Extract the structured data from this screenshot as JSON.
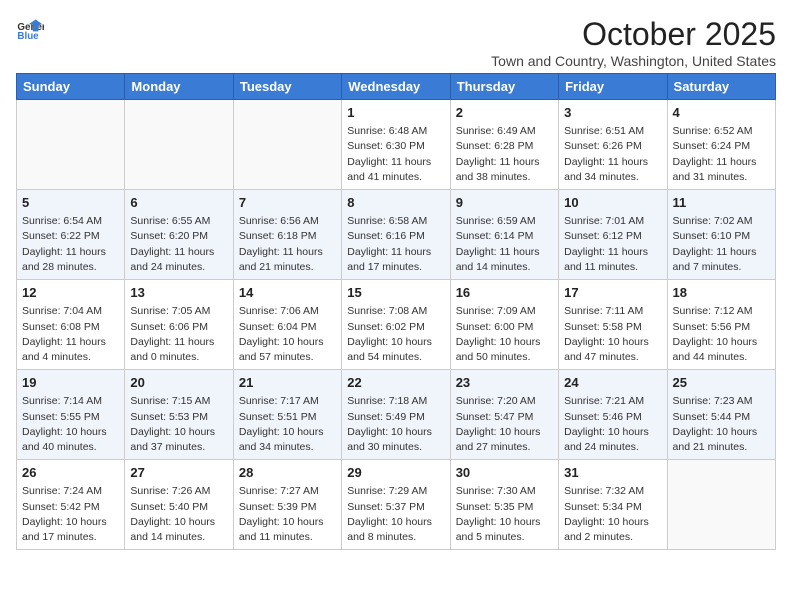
{
  "logo": {
    "general": "General",
    "blue": "Blue"
  },
  "title": "October 2025",
  "subtitle": "Town and Country, Washington, United States",
  "days_header": [
    "Sunday",
    "Monday",
    "Tuesday",
    "Wednesday",
    "Thursday",
    "Friday",
    "Saturday"
  ],
  "weeks": [
    [
      {
        "num": "",
        "info": ""
      },
      {
        "num": "",
        "info": ""
      },
      {
        "num": "",
        "info": ""
      },
      {
        "num": "1",
        "info": "Sunrise: 6:48 AM\nSunset: 6:30 PM\nDaylight: 11 hours\nand 41 minutes."
      },
      {
        "num": "2",
        "info": "Sunrise: 6:49 AM\nSunset: 6:28 PM\nDaylight: 11 hours\nand 38 minutes."
      },
      {
        "num": "3",
        "info": "Sunrise: 6:51 AM\nSunset: 6:26 PM\nDaylight: 11 hours\nand 34 minutes."
      },
      {
        "num": "4",
        "info": "Sunrise: 6:52 AM\nSunset: 6:24 PM\nDaylight: 11 hours\nand 31 minutes."
      }
    ],
    [
      {
        "num": "5",
        "info": "Sunrise: 6:54 AM\nSunset: 6:22 PM\nDaylight: 11 hours\nand 28 minutes."
      },
      {
        "num": "6",
        "info": "Sunrise: 6:55 AM\nSunset: 6:20 PM\nDaylight: 11 hours\nand 24 minutes."
      },
      {
        "num": "7",
        "info": "Sunrise: 6:56 AM\nSunset: 6:18 PM\nDaylight: 11 hours\nand 21 minutes."
      },
      {
        "num": "8",
        "info": "Sunrise: 6:58 AM\nSunset: 6:16 PM\nDaylight: 11 hours\nand 17 minutes."
      },
      {
        "num": "9",
        "info": "Sunrise: 6:59 AM\nSunset: 6:14 PM\nDaylight: 11 hours\nand 14 minutes."
      },
      {
        "num": "10",
        "info": "Sunrise: 7:01 AM\nSunset: 6:12 PM\nDaylight: 11 hours\nand 11 minutes."
      },
      {
        "num": "11",
        "info": "Sunrise: 7:02 AM\nSunset: 6:10 PM\nDaylight: 11 hours\nand 7 minutes."
      }
    ],
    [
      {
        "num": "12",
        "info": "Sunrise: 7:04 AM\nSunset: 6:08 PM\nDaylight: 11 hours\nand 4 minutes."
      },
      {
        "num": "13",
        "info": "Sunrise: 7:05 AM\nSunset: 6:06 PM\nDaylight: 11 hours\nand 0 minutes."
      },
      {
        "num": "14",
        "info": "Sunrise: 7:06 AM\nSunset: 6:04 PM\nDaylight: 10 hours\nand 57 minutes."
      },
      {
        "num": "15",
        "info": "Sunrise: 7:08 AM\nSunset: 6:02 PM\nDaylight: 10 hours\nand 54 minutes."
      },
      {
        "num": "16",
        "info": "Sunrise: 7:09 AM\nSunset: 6:00 PM\nDaylight: 10 hours\nand 50 minutes."
      },
      {
        "num": "17",
        "info": "Sunrise: 7:11 AM\nSunset: 5:58 PM\nDaylight: 10 hours\nand 47 minutes."
      },
      {
        "num": "18",
        "info": "Sunrise: 7:12 AM\nSunset: 5:56 PM\nDaylight: 10 hours\nand 44 minutes."
      }
    ],
    [
      {
        "num": "19",
        "info": "Sunrise: 7:14 AM\nSunset: 5:55 PM\nDaylight: 10 hours\nand 40 minutes."
      },
      {
        "num": "20",
        "info": "Sunrise: 7:15 AM\nSunset: 5:53 PM\nDaylight: 10 hours\nand 37 minutes."
      },
      {
        "num": "21",
        "info": "Sunrise: 7:17 AM\nSunset: 5:51 PM\nDaylight: 10 hours\nand 34 minutes."
      },
      {
        "num": "22",
        "info": "Sunrise: 7:18 AM\nSunset: 5:49 PM\nDaylight: 10 hours\nand 30 minutes."
      },
      {
        "num": "23",
        "info": "Sunrise: 7:20 AM\nSunset: 5:47 PM\nDaylight: 10 hours\nand 27 minutes."
      },
      {
        "num": "24",
        "info": "Sunrise: 7:21 AM\nSunset: 5:46 PM\nDaylight: 10 hours\nand 24 minutes."
      },
      {
        "num": "25",
        "info": "Sunrise: 7:23 AM\nSunset: 5:44 PM\nDaylight: 10 hours\nand 21 minutes."
      }
    ],
    [
      {
        "num": "26",
        "info": "Sunrise: 7:24 AM\nSunset: 5:42 PM\nDaylight: 10 hours\nand 17 minutes."
      },
      {
        "num": "27",
        "info": "Sunrise: 7:26 AM\nSunset: 5:40 PM\nDaylight: 10 hours\nand 14 minutes."
      },
      {
        "num": "28",
        "info": "Sunrise: 7:27 AM\nSunset: 5:39 PM\nDaylight: 10 hours\nand 11 minutes."
      },
      {
        "num": "29",
        "info": "Sunrise: 7:29 AM\nSunset: 5:37 PM\nDaylight: 10 hours\nand 8 minutes."
      },
      {
        "num": "30",
        "info": "Sunrise: 7:30 AM\nSunset: 5:35 PM\nDaylight: 10 hours\nand 5 minutes."
      },
      {
        "num": "31",
        "info": "Sunrise: 7:32 AM\nSunset: 5:34 PM\nDaylight: 10 hours\nand 2 minutes."
      },
      {
        "num": "",
        "info": ""
      }
    ]
  ]
}
